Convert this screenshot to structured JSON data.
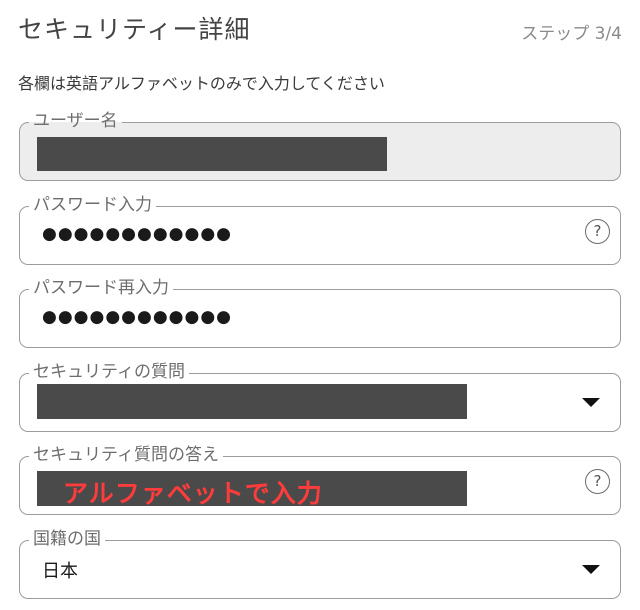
{
  "header": {
    "title": "セキュリティー詳細",
    "step": "ステップ 3/4"
  },
  "instruction": "各欄は英語アルファベットのみで入力してください",
  "fields": {
    "username": {
      "label": "ユーザー名"
    },
    "password": {
      "label": "パスワード入力",
      "masked_value": "●●●●●●●●●●●●",
      "help": "?"
    },
    "password_confirm": {
      "label": "パスワード再入力",
      "masked_value": "●●●●●●●●●●●●"
    },
    "security_question": {
      "label": "セキュリティの質問"
    },
    "security_answer": {
      "label": "セキュリティ質問の答え",
      "help": "?",
      "annotation": "アルファベットで入力"
    },
    "country": {
      "label": "国籍の国",
      "value": "日本"
    }
  },
  "colors": {
    "border": "#9c9c9c",
    "readonly_bg": "#ededed",
    "redaction": "#4a4a4a",
    "annotation": "#ff3b3b"
  },
  "icons": [
    "help-icon",
    "dropdown-caret-icon"
  ]
}
